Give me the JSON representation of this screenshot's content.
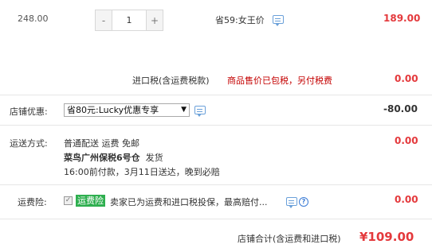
{
  "item": {
    "original_price": "248.00",
    "quantity": "1",
    "minus_label": "-",
    "plus_label": "+",
    "promo": "省59:女王价",
    "price": "189.00"
  },
  "import_tax": {
    "label": "进口税(含运费税款)",
    "note": "商品售价已包税，另付税费",
    "value": "0.00"
  },
  "shop_discount": {
    "label": "店铺优惠:",
    "selected_option": "省80元:Lucky优惠专享",
    "value": "-80.00"
  },
  "shipping": {
    "label": "运送方式:",
    "line1": "普通配送 运费 免邮",
    "warehouse": "菜鸟广州保税6号仓",
    "dispatch": "发货",
    "line3": "16:00前付款，3月11日送达，晚到必赔",
    "value": "0.00"
  },
  "insurance": {
    "label": "运费险:",
    "checkbox_mark": "✓",
    "tag": "运费险",
    "description": "卖家已为运费和进口税投保，最高赔付...",
    "help_glyph": "?",
    "value": "0.00"
  },
  "total": {
    "label": "店铺合计(含运费和进口税)",
    "value": "¥109.00"
  },
  "colors": {
    "accent_red": "#e4393c",
    "tax_note_red": "#c40000",
    "insurance_green": "#2eaf4f",
    "icon_blue": "#6aa0d9"
  },
  "icons": [
    "chat-icon",
    "help-icon",
    "dropdown-arrow-icon",
    "checkbox"
  ]
}
